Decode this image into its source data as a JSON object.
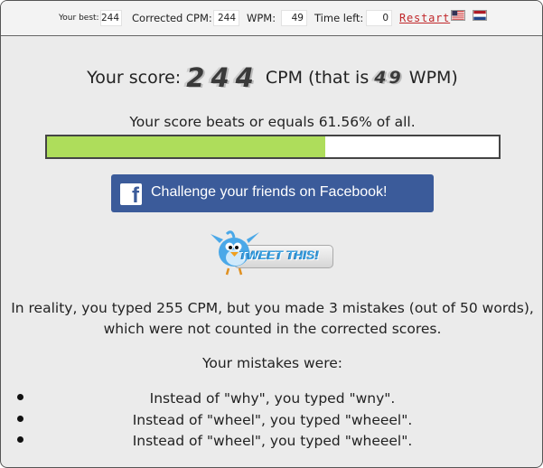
{
  "topbar": {
    "best_label": "Your best:",
    "best_value": "244",
    "cpm_label": "Corrected CPM:",
    "cpm_value": "244",
    "wpm_label": "WPM:",
    "wpm_value": "49",
    "time_label": "Time left:",
    "time_value": "0",
    "restart_label": "Restart",
    "flags": [
      "us-flag-icon",
      "nl-flag-icon"
    ]
  },
  "score": {
    "prefix": "Your score:",
    "cpm": "244",
    "middle": "CPM (that is",
    "wpm": "49",
    "suffix": "WPM)"
  },
  "beats_text": "Your score beats or equals 61.56% of all.",
  "progress_fraction": 0.6156,
  "facebook": {
    "icon": "facebook-icon",
    "label": "Challenge your friends on Facebook!",
    "color": "#3b5b9a"
  },
  "tweet": {
    "label": "TWEET THIS!",
    "icon": "twitter-bird-icon"
  },
  "reality_line1": "In reality, you typed 255 CPM, but you made 3 mistakes (out of 50 words),",
  "reality_line2": "which were not counted in the corrected scores.",
  "mistakes_title": "Your mistakes were:",
  "mistakes": [
    "Instead of \"why\", you typed \"wny\".",
    "Instead of \"wheel\", you typed \"wheeel\".",
    "Instead of \"wheel\", you typed \"wheeel\"."
  ],
  "colors": {
    "progress_fill": "#aedd5b",
    "restart": "#c0282b",
    "background": "#ebebeb"
  }
}
